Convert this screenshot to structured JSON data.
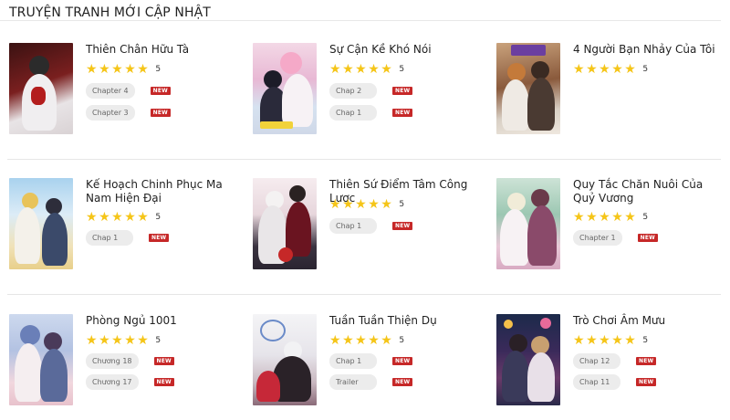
{
  "section_title": "TRUYỆN TRANH MỚI CẬP NHẬT",
  "rating_value": "5",
  "new_label": "NEW",
  "colors": {
    "star": "#f5c518",
    "badge": "#c62828",
    "chip_bg": "#ececec"
  },
  "cards": [
    {
      "title": "Thiên Chân Hữu Tà",
      "chapters": [
        "Chapter 4",
        "Chapter 3"
      ]
    },
    {
      "title": "Sự Cận Kề Khó Nói",
      "chapters": [
        "Chap 2",
        "Chap 1"
      ]
    },
    {
      "title": "4 Người Bạn Nhảy Của Tôi",
      "chapters": []
    },
    {
      "title": "Kế Hoạch Chinh Phục Ma Nam Hiện Đại",
      "chapters": [
        "Chap 1"
      ]
    },
    {
      "title": "Thiên Sứ Điểm Tâm Công Lược",
      "chapters": [
        "Chap 1"
      ]
    },
    {
      "title": "Quy Tắc Chăn Nuôi Của Quỷ Vương",
      "chapters": [
        "Chapter 1"
      ]
    },
    {
      "title": "Phòng Ngủ 1001",
      "chapters": [
        "Chương 18",
        "Chương 17"
      ]
    },
    {
      "title": "Tuần Tuần Thiện Dụ",
      "chapters": [
        "Chap 1",
        "Trailer"
      ]
    },
    {
      "title": "Trò Chơi Âm Mưu",
      "chapters": [
        "Chap 12",
        "Chap 11"
      ]
    }
  ]
}
